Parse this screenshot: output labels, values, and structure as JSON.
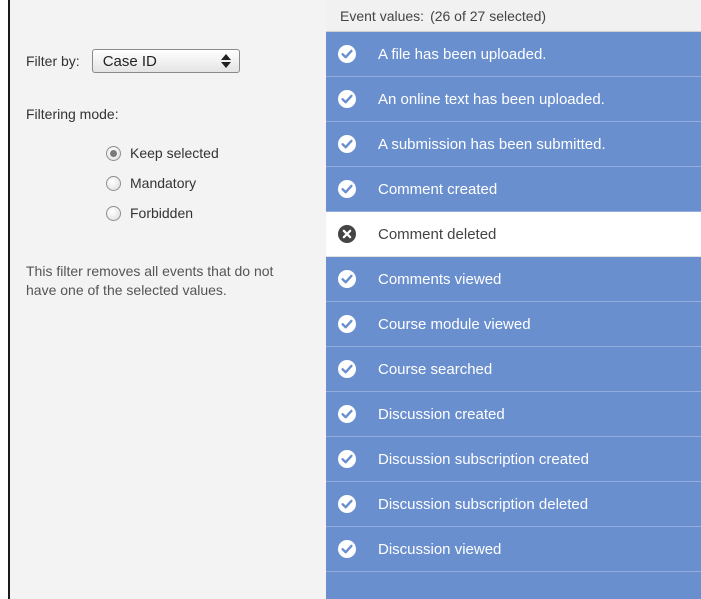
{
  "filter": {
    "label": "Filter by:",
    "selected": "Case ID"
  },
  "mode": {
    "label": "Filtering mode:",
    "options": [
      {
        "label": "Keep selected",
        "checked": true
      },
      {
        "label": "Mandatory",
        "checked": false
      },
      {
        "label": "Forbidden",
        "checked": false
      }
    ]
  },
  "description": "This filter removes all events that do not have one of the selected values.",
  "events": {
    "header_label": "Event values:",
    "header_count": "(26 of 27 selected)",
    "items": [
      {
        "label": "A file has been uploaded.",
        "selected": true
      },
      {
        "label": "An online text has been uploaded.",
        "selected": true
      },
      {
        "label": "A submission has been submitted.",
        "selected": true
      },
      {
        "label": "Comment created",
        "selected": true
      },
      {
        "label": "Comment deleted",
        "selected": false
      },
      {
        "label": "Comments viewed",
        "selected": true
      },
      {
        "label": "Course module viewed",
        "selected": true
      },
      {
        "label": "Course searched",
        "selected": true
      },
      {
        "label": "Discussion created",
        "selected": true
      },
      {
        "label": "Discussion subscription created",
        "selected": true
      },
      {
        "label": "Discussion subscription deleted",
        "selected": true
      },
      {
        "label": "Discussion viewed",
        "selected": true
      }
    ]
  },
  "colors": {
    "selected_bg": "#6a8fcf",
    "unselected_bg": "#ffffff",
    "panel_bg": "#f3f3f3"
  }
}
